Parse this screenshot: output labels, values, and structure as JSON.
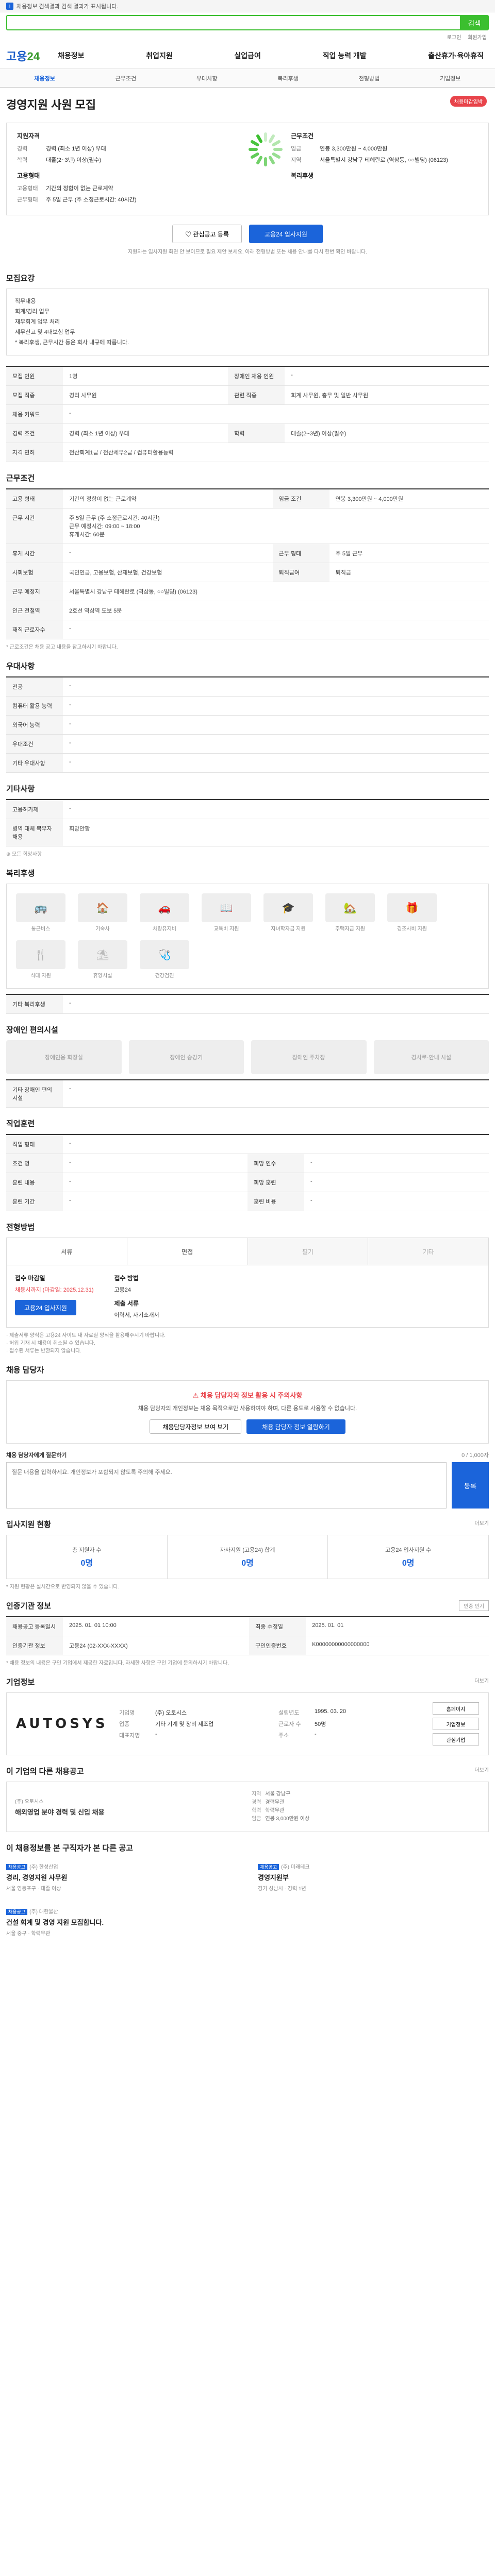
{
  "top_notice": "채용정보 검색결과 검색 결과가 표시됩니다.",
  "search": {
    "placeholder": "",
    "button": "검색"
  },
  "utility": [
    "로그인",
    "회원가입"
  ],
  "logo": {
    "main": "고용",
    "accent": "24"
  },
  "gnb": [
    "채용정보",
    "취업지원",
    "실업급여",
    "직업 능력 개발",
    "출산휴가·육아휴직"
  ],
  "subtabs": [
    "채용정보",
    "근무조건",
    "우대사항",
    "복리후생",
    "전형방법",
    "기업정보"
  ],
  "job": {
    "title": "경영지원 사원 모집",
    "badge": "채용마감임박",
    "summary": {
      "left_head": "지원자격",
      "left": [
        {
          "k": "경력",
          "v": "경력 (최소 1년 이상) 우대"
        },
        {
          "k": "학력",
          "v": "대졸(2~3년) 이상(필수)"
        }
      ],
      "right_head": "근무조건",
      "right": [
        {
          "k": "임금",
          "v": "연봉 3,300만원 ~ 4,000만원"
        },
        {
          "k": "지역",
          "v": "서울특별시 강남구 테헤란로 (역삼동, ○○빌딩) (06123)"
        }
      ],
      "left2_head": "고용형태",
      "left2": [
        {
          "k": "고용형태",
          "v": "기간의 정함이 없는 근로계약"
        },
        {
          "k": "근무형태",
          "v": "주 5일 근무 (주 소정근로시간: 40시간)"
        }
      ],
      "right2_head": "복리후생",
      "right2": []
    },
    "btn_save": "관심공고 등록",
    "btn_apply": "고용24 입사지원",
    "note": "지원자는 입사지원 화면 안 보이므로 필요 제안 보세요. 아래 전형방법 또는 채용 안내를 다시 한번 확인 바랍니다."
  },
  "recruit": {
    "title": "모집요강",
    "body": "직무내용\n회계/경리 업무\n재무회계 업무 처리\n세무신고 및 4대보험 업무\n* 복리후생, 근무시간 등은 회사 내규에 따릅니다."
  },
  "recruit_table": [
    {
      "k": "모집 인원",
      "v": "1명",
      "k2": "장애인 채용 인원",
      "v2": "-"
    },
    {
      "k": "모집 직종",
      "v": "경리 사무원",
      "k2": "관련 직종",
      "v2": "회계 사무원, 총무 및 일반 사무원"
    },
    {
      "k": "채용 키워드",
      "v": "-",
      "k2": "",
      "v2": ""
    },
    {
      "k": "경력 조건",
      "v": "경력 (최소 1년 이상) 우대",
      "k2": "학력",
      "v2": "대졸(2~3년) 이상(필수)"
    },
    {
      "k": "자격 면허",
      "v": "전산회계1급  /  전산세무2급 / 컴퓨터활용능력",
      "k2": "",
      "v2": ""
    }
  ],
  "work": {
    "title": "근무조건",
    "rows": [
      {
        "k": "고용 형태",
        "v": "기간의 정함이 없는 근로계약",
        "k2": "임금 조건",
        "v2": "연봉 3,300만원 ~ 4,000만원"
      },
      {
        "k": "근무 시간",
        "v": "주 5일 근무  (주 소정근로시간: 40시간)\n근무 예정시간: 09:00 ~ 18:00\n휴게시간: 60분",
        "k2": "",
        "v2": ""
      },
      {
        "k": "휴게 시간",
        "v": "-",
        "k2": "근무 형태",
        "v2": "주 5일 근무"
      },
      {
        "k": "사회보험",
        "v": "국민연금, 고용보험, 산재보험, 건강보험",
        "k2": "퇴직급여",
        "v2": "퇴직금"
      },
      {
        "k": "근무 예정지",
        "v": "서울특별시 강남구 테헤란로 (역삼동, ○○빌딩) (06123)",
        "k2": "",
        "v2": ""
      },
      {
        "k": "인근 전철역",
        "v": "2호선 역삼역 도보 5분",
        "k2": "",
        "v2": ""
      },
      {
        "k": "재직 근로자수",
        "v": "-",
        "k2": "",
        "v2": ""
      }
    ],
    "link": "지도보기",
    "note": "* 근로조건은 채용 공고 내용을 참고하시기 바랍니다."
  },
  "pref": {
    "title": "우대사항",
    "rows": [
      {
        "k": "전공",
        "v": "-"
      },
      {
        "k": "컴퓨터 활용 능력",
        "v": "-"
      },
      {
        "k": "외국어 능력",
        "v": "-"
      },
      {
        "k": "우대조건",
        "v": "-"
      },
      {
        "k": "기타 우대사항",
        "v": "-"
      }
    ]
  },
  "etc": {
    "title": "기타사항",
    "rows": [
      {
        "k": "고용허가제",
        "v": "-"
      },
      {
        "k": "병역 대체 복무자 채용",
        "v": "희망안함"
      }
    ],
    "sub": "모든 희망사항"
  },
  "welfare": {
    "title": "복리후생",
    "items": [
      "통근버스",
      "기숙사",
      "차량유지비",
      "교육비 지원",
      "자녀학자금 지원",
      "주택자금 지원",
      "경조사비 지원",
      "식대 지원",
      "휴양시설",
      "건강검진"
    ],
    "sub": "기타 복리후생",
    "sub_value": "-"
  },
  "disability": {
    "title": "장애인 편의시설",
    "items": [
      "장애인용 화장실",
      "장애인 승강기",
      "장애인 주차장",
      "경사로·안내 시설"
    ],
    "sub": "기타 장애인 편의시설",
    "sub_value": "-"
  },
  "intro": {
    "title": "직업훈련",
    "rows": [
      {
        "k": "직업 형태",
        "v": "-",
        "k2": "",
        "v2": ""
      },
      {
        "k": "조건 명",
        "v": "-",
        "k2": "희망 연수",
        "v2": "-"
      },
      {
        "k": "훈련 내용",
        "v": "-",
        "k2": "희망 훈련",
        "v2": "-"
      },
      {
        "k": "훈련 기간",
        "v": "-",
        "k2": "훈련 비용",
        "v2": "-"
      }
    ]
  },
  "process": {
    "title": "전형방법",
    "steps": [
      "서류",
      "면접",
      "필기",
      "기타"
    ],
    "apply_head": "접수 마감일",
    "apply_val": "채용시까지 (마감일: 2025.12.31)",
    "method_head": "접수 방법",
    "method_val": "고용24",
    "doc_head": "제출 서류",
    "doc_val": "이력서, 자기소개서",
    "btn": "고용24 입사지원",
    "notes": [
      "· 제출서류 양식은 고용24 사이트 내 자료실 양식을 활용해주시기 바랍니다.",
      "· 허위 기재 시 채용이 취소될 수 있습니다.",
      "· 접수된 서류는 반환되지 않습니다."
    ]
  },
  "qa": {
    "title": "채용 담당자",
    "warn": "채용 담당자와 정보 활용 시 주의사항",
    "desc": "채용 담당자의 개인정보는 채용 목적으로만 사용하여야 하며, 다른 용도로 사용할 수 없습니다.",
    "btn1": "채용담당자정보 보여 보기",
    "btn2": "채용 담당자 정보 열람하기",
    "label": "채용 담당자에게 질문하기",
    "counter": "0 / 1,000자",
    "placeholder": "질문 내용을 입력하세요. 개인정보가 포함되지 않도록 주의해 주세요.",
    "submit": "등록"
  },
  "stats": {
    "title": "입사지원 현황",
    "more": "더보기",
    "items": [
      {
        "label": "총 지원자 수",
        "num": "0명"
      },
      {
        "label": "자사지원 (고용24) 합계",
        "num": "0명"
      },
      {
        "label": "고용24 입사지원 수",
        "num": "0명"
      }
    ],
    "note": "* 지원 현황은 실시간으로 반영되지 않을 수 있습니다."
  },
  "info": {
    "title": "인증기관 정보",
    "btn": "인증 인기",
    "rows": [
      {
        "k": "채용공고 등록일시",
        "v": "2025. 01. 01  10:00",
        "k2": "최종 수정일",
        "v2": "2025. 01. 01"
      },
      {
        "k": "인증기관 정보",
        "v": "고용24 (02-XXX-XXXX)",
        "k2": "구인인증번호",
        "v2": "K00000000000000000"
      }
    ],
    "note": "* 채용 정보의 내용은 구인 기업에서 제공한 자료입니다. 자세한 사항은 구인 기업에 문의하시기 바랍니다."
  },
  "corp": {
    "title": "기업정보",
    "more": "더보기",
    "logo": "AUTOSYS",
    "rows": [
      {
        "k": "기업명",
        "v": "(주) 오토시스",
        "k2": "설립년도",
        "v2": "1995. 03. 20"
      },
      {
        "k": "업종",
        "v": "기타 기계 및 장비 제조업",
        "k2": "근로자 수",
        "v2": "50명"
      },
      {
        "k": "대표자명",
        "v": "-",
        "k2": "주소",
        "v2": "-"
      }
    ],
    "btns": [
      "홈페이지",
      "기업정보",
      "관심기업"
    ]
  },
  "other": {
    "title": "이 기업의 다른 채용공고",
    "more": "더보기",
    "co": "(주) 오토시스",
    "ti": "해외영업 분야 경력 및 신입 채용",
    "meta": [
      {
        "k": "지역",
        "v": "서울 강남구"
      },
      {
        "k": "경력",
        "v": "경력무관"
      },
      {
        "k": "학력",
        "v": "학력무관"
      },
      {
        "k": "임금",
        "v": "연봉 3,000만원 이상"
      }
    ]
  },
  "recommend": {
    "title": "이 채용정보를 본 구직자가 본 다른 공고",
    "items": [
      {
        "tag": "채용공고",
        "co": "(주) 한성산업",
        "ti": "경리, 경영지원 사무원",
        "meta": "서울 영등포구  ·  대졸 이상"
      },
      {
        "tag": "채용공고",
        "co": "(주) 미래테크",
        "ti": "경영지원부",
        "meta": "경기 성남시  ·  경력 1년"
      },
      {
        "tag": "채용공고",
        "co": "(주) 대한물산",
        "ti": "건설 회계 및 경영 지원 모집합니다.",
        "meta": "서울 중구  ·  학력무관"
      }
    ]
  }
}
